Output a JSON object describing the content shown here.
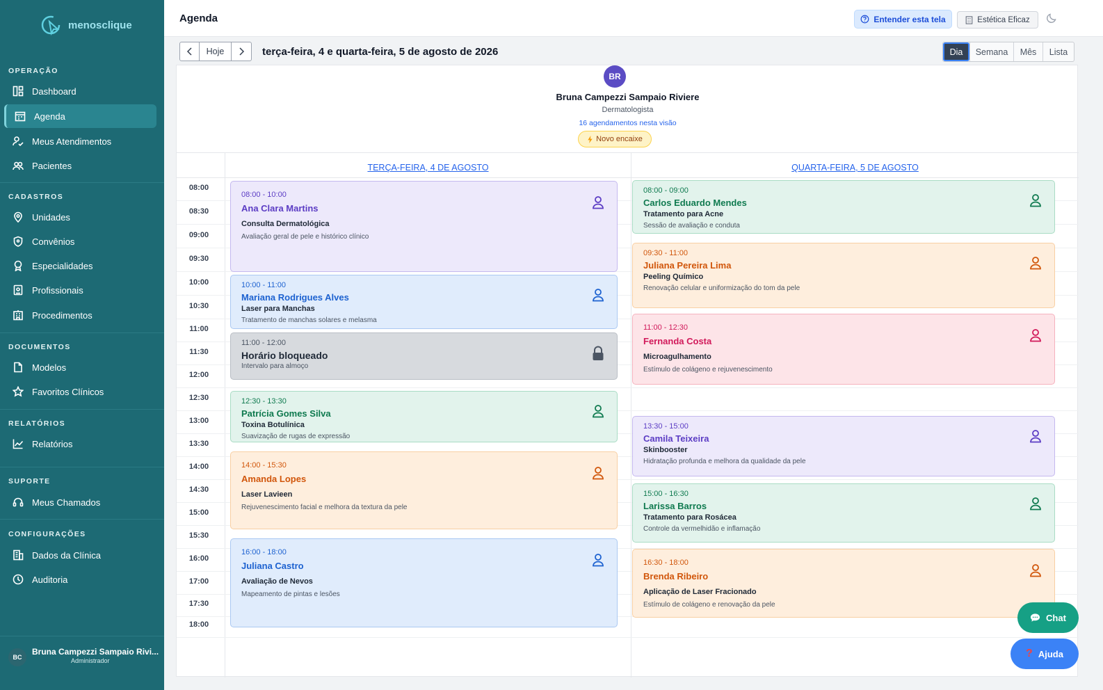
{
  "app": {
    "brand": "menosclique"
  },
  "sidebar": {
    "sections": [
      {
        "title": "OPERAÇÃO",
        "items": [
          {
            "label": "Dashboard",
            "icon": "dashboard-icon"
          },
          {
            "label": "Agenda",
            "icon": "calendar-icon"
          },
          {
            "label": "Meus Atendimentos",
            "icon": "user-check-icon"
          },
          {
            "label": "Pacientes",
            "icon": "users-icon"
          }
        ]
      },
      {
        "title": "CADASTROS",
        "items": [
          {
            "label": "Unidades",
            "icon": "map-pin-icon"
          },
          {
            "label": "Convênios",
            "icon": "shield-icon"
          },
          {
            "label": "Especialidades",
            "icon": "award-icon"
          },
          {
            "label": "Profissionais",
            "icon": "id-badge-icon"
          },
          {
            "label": "Procedimentos",
            "icon": "building-icon"
          }
        ]
      },
      {
        "title": "DOCUMENTOS",
        "items": [
          {
            "label": "Modelos",
            "icon": "file-icon"
          },
          {
            "label": "Favoritos Clínicos",
            "icon": "star-icon"
          }
        ]
      },
      {
        "title": "RELATÓRIOS",
        "items": [
          {
            "label": "Relatórios",
            "icon": "chart-line-icon"
          }
        ]
      },
      {
        "title": "SUPORTE",
        "items": [
          {
            "label": "Meus Chamados",
            "icon": "headset-icon"
          }
        ]
      },
      {
        "title": "CONFIGURAÇÕES",
        "items": [
          {
            "label": "Dados da Clínica",
            "icon": "building-icon"
          },
          {
            "label": "Auditoria",
            "icon": "clock-icon"
          }
        ]
      }
    ],
    "user": {
      "initials": "BC",
      "name": "Bruna Campezzi Sampaio Rivi...",
      "role": "Administrador"
    }
  },
  "header": {
    "title": "Agenda",
    "understand": "Entender esta tela",
    "clinic": "Estética Eficaz"
  },
  "toolbar": {
    "today": "Hoje",
    "date_title": "terça-feira, 4 e quarta-feira, 5 de agosto de 2026",
    "views": [
      "Dia",
      "Semana",
      "Mês",
      "Lista"
    ]
  },
  "professional": {
    "initials": "BR",
    "name": "Bruna Campezzi Sampaio Riviere",
    "specialty": "Dermatologista",
    "count": "16 agendamentos nesta visão",
    "encaixe": "Novo encaixe"
  },
  "days": [
    "TERÇA-FEIRA, 4 DE AGOSTO",
    "QUARTA-FEIRA, 5 DE AGOSTO"
  ],
  "times": [
    "08:00",
    "08:30",
    "09:00",
    "09:30",
    "10:00",
    "10:30",
    "11:00",
    "11:30",
    "12:00",
    "12:30",
    "13:00",
    "13:30",
    "14:00",
    "14:30",
    "15:00",
    "15:30",
    "16:00",
    "17:00",
    "17:30",
    "18:00"
  ],
  "day1": [
    {
      "time": "08:00 - 10:00",
      "name": "Ana Clara Martins",
      "proc": "Consulta Dermatológica",
      "desc": "Avaliação geral de pele e histórico clínico",
      "color": "purple"
    },
    {
      "time": "10:00 - 11:00",
      "name": "Mariana Rodrigues Alves",
      "proc": "Laser para Manchas",
      "desc": "Tratamento de manchas solares e melasma",
      "color": "blue"
    },
    {
      "time": "11:00 - 12:00",
      "name": "Horário bloqueado",
      "proc": "",
      "desc": "Intervalo para almoço",
      "color": "gray"
    },
    {
      "time": "12:30 - 13:30",
      "name": "Patrícia Gomes Silva",
      "proc": "Toxina Botulínica",
      "desc": "Suavização de rugas de expressão",
      "color": "green"
    },
    {
      "time": "14:00 - 15:30",
      "name": "Amanda Lopes",
      "proc": "Laser Lavieen",
      "desc": "Rejuvenescimento facial e melhora da textura da pele",
      "color": "orange"
    },
    {
      "time": "16:00 - 18:00",
      "name": "Juliana Castro",
      "proc": "Avaliação de Nevos",
      "desc": "Mapeamento de pintas e lesões",
      "color": "blue"
    }
  ],
  "day2": [
    {
      "time": "08:00 - 09:00",
      "name": "Carlos Eduardo Mendes",
      "proc": "Tratamento para Acne",
      "desc": "Sessão de avaliação e conduta",
      "color": "green"
    },
    {
      "time": "09:30 - 11:00",
      "name": "Juliana Pereira Lima",
      "proc": "Peeling Químico",
      "desc": "Renovação celular e uniformização do tom da pele",
      "color": "orange"
    },
    {
      "time": "11:00 - 12:30",
      "name": "Fernanda Costa",
      "proc": "Microagulhamento",
      "desc": "Estímulo de colágeno e rejuvenescimento",
      "color": "pink"
    },
    {
      "time": "13:30 - 15:00",
      "name": "Camila Teixeira",
      "proc": "Skinbooster",
      "desc": "Hidratação profunda e melhora da qualidade da pele",
      "color": "purple"
    },
    {
      "time": "15:00 - 16:30",
      "name": "Larissa Barros",
      "proc": "Tratamento para Rosácea",
      "desc": "Controle da vermelhidão e inflamação",
      "color": "green"
    },
    {
      "time": "16:30 - 18:00",
      "name": "Brenda Ribeiro",
      "proc": "Aplicação de Laser Fracionado",
      "desc": "Estímulo de colágeno e renovação da pele",
      "color": "orange"
    }
  ],
  "fabs": {
    "chat": "Chat",
    "help": "Ajuda"
  }
}
